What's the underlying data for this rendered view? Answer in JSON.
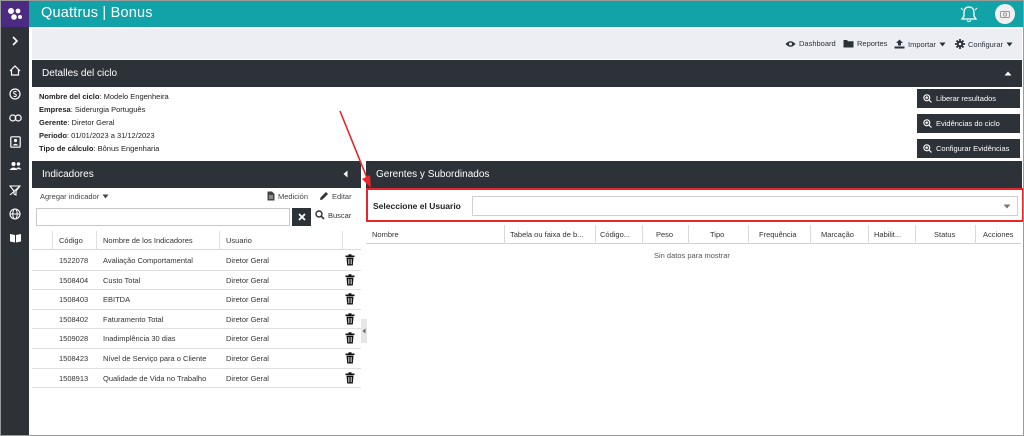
{
  "app": {
    "title": "Quattrus | Bonus"
  },
  "toolbar": {
    "items": [
      {
        "label": "Dashboard",
        "icon": "eye-icon"
      },
      {
        "label": "Reportes",
        "icon": "folder-icon"
      },
      {
        "label": "Importar",
        "icon": "upload-icon"
      },
      {
        "label": "Configurar",
        "icon": "gear-icon"
      }
    ]
  },
  "details": {
    "title": "Detalles del ciclo",
    "fields": [
      {
        "label": "Nombre del ciclo",
        "value": ": Modelo Engenheira"
      },
      {
        "label": "Empresa",
        "value": ": Siderurgia Português"
      },
      {
        "label": "Gerente",
        "value": ": Diretor Geral"
      },
      {
        "label": "Periodo",
        "value": ": 01/01/2023 a 31/12/2023"
      },
      {
        "label": "Tipo de cálculo",
        "value": ": Bônus Engenharia"
      }
    ],
    "buttons": [
      "Liberar resultados",
      "Evidências do ciclo",
      "Configurar Evidências"
    ]
  },
  "indicators": {
    "title": "Indicadores",
    "add_label": "Agregar indicador",
    "medicion_label": "Medición",
    "edit_label": "Editar",
    "search_label": "Buscar",
    "search_placeholder": "",
    "columns": [
      "Código",
      "Nombre de los Indicadores",
      "Usuario"
    ],
    "rows": [
      {
        "code": "1522078",
        "name": "Avaliação Comportamental",
        "user": "Diretor Geral"
      },
      {
        "code": "1508404",
        "name": "Custo Total",
        "user": "Diretor Geral"
      },
      {
        "code": "1508403",
        "name": "EBITDA",
        "user": "Diretor Geral"
      },
      {
        "code": "1508402",
        "name": "Faturamento Total",
        "user": "Diretor Geral"
      },
      {
        "code": "1509028",
        "name": "Inadimplência 30 dias",
        "user": "Diretor Geral"
      },
      {
        "code": "1508423",
        "name": "Nível de Serviço para o Cliente",
        "user": "Diretor Geral"
      },
      {
        "code": "1508913",
        "name": "Qualidade de Vida no Trabalho",
        "user": "Diretor Geral"
      }
    ]
  },
  "managers": {
    "title": "Gerentes y Subordinados",
    "select_label": "Seleccione el Usuario",
    "select_value": "",
    "columns": [
      "Nombre",
      "Tabela ou faixa de b...",
      "Código...",
      "Peso",
      "Tipo",
      "Frequência",
      "Marcação",
      "Habilit...",
      "Status",
      "Acciones"
    ],
    "empty_text": "Sin datos para mostrar"
  },
  "colors": {
    "topbar": "#12a3a8",
    "logo": "#4b2a82",
    "dark": "#2d3138",
    "highlight": "#e8262b"
  }
}
